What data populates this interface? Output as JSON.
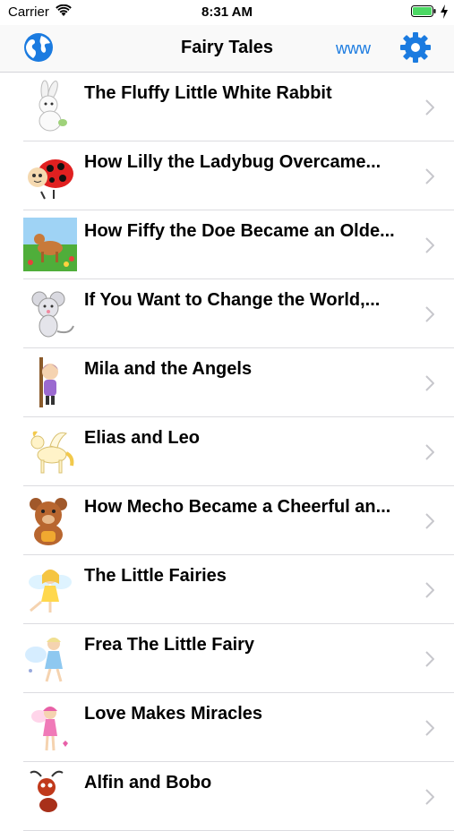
{
  "status_bar": {
    "carrier": "Carrier",
    "time": "8:31 AM",
    "battery_color": "#4cd964"
  },
  "nav_bar": {
    "title": "Fairy Tales",
    "www_label": "www",
    "accent_color": "#1b7be0"
  },
  "stories": [
    {
      "title": "The Fluffy Little White Rabbit",
      "icon": "rabbit-icon"
    },
    {
      "title": "How Lilly the Ladybug Overcame...",
      "icon": "ladybug-icon"
    },
    {
      "title": "How Fiffy the Doe Became an Olde...",
      "icon": "doe-icon"
    },
    {
      "title": "If You Want to Change the World,...",
      "icon": "mouse-icon"
    },
    {
      "title": "Mila and the Angels",
      "icon": "girl-icon"
    },
    {
      "title": "Elias and Leo",
      "icon": "pegasus-icon"
    },
    {
      "title": "How Mecho Became a Cheerful an...",
      "icon": "bear-icon"
    },
    {
      "title": "The Little Fairies",
      "icon": "fairy-icon"
    },
    {
      "title": "Frea The Little Fairy",
      "icon": "fairy-blue-icon"
    },
    {
      "title": "Love Makes Miracles",
      "icon": "fairy-pink-icon"
    },
    {
      "title": "Alfin and Bobo",
      "icon": "ant-icon"
    }
  ]
}
